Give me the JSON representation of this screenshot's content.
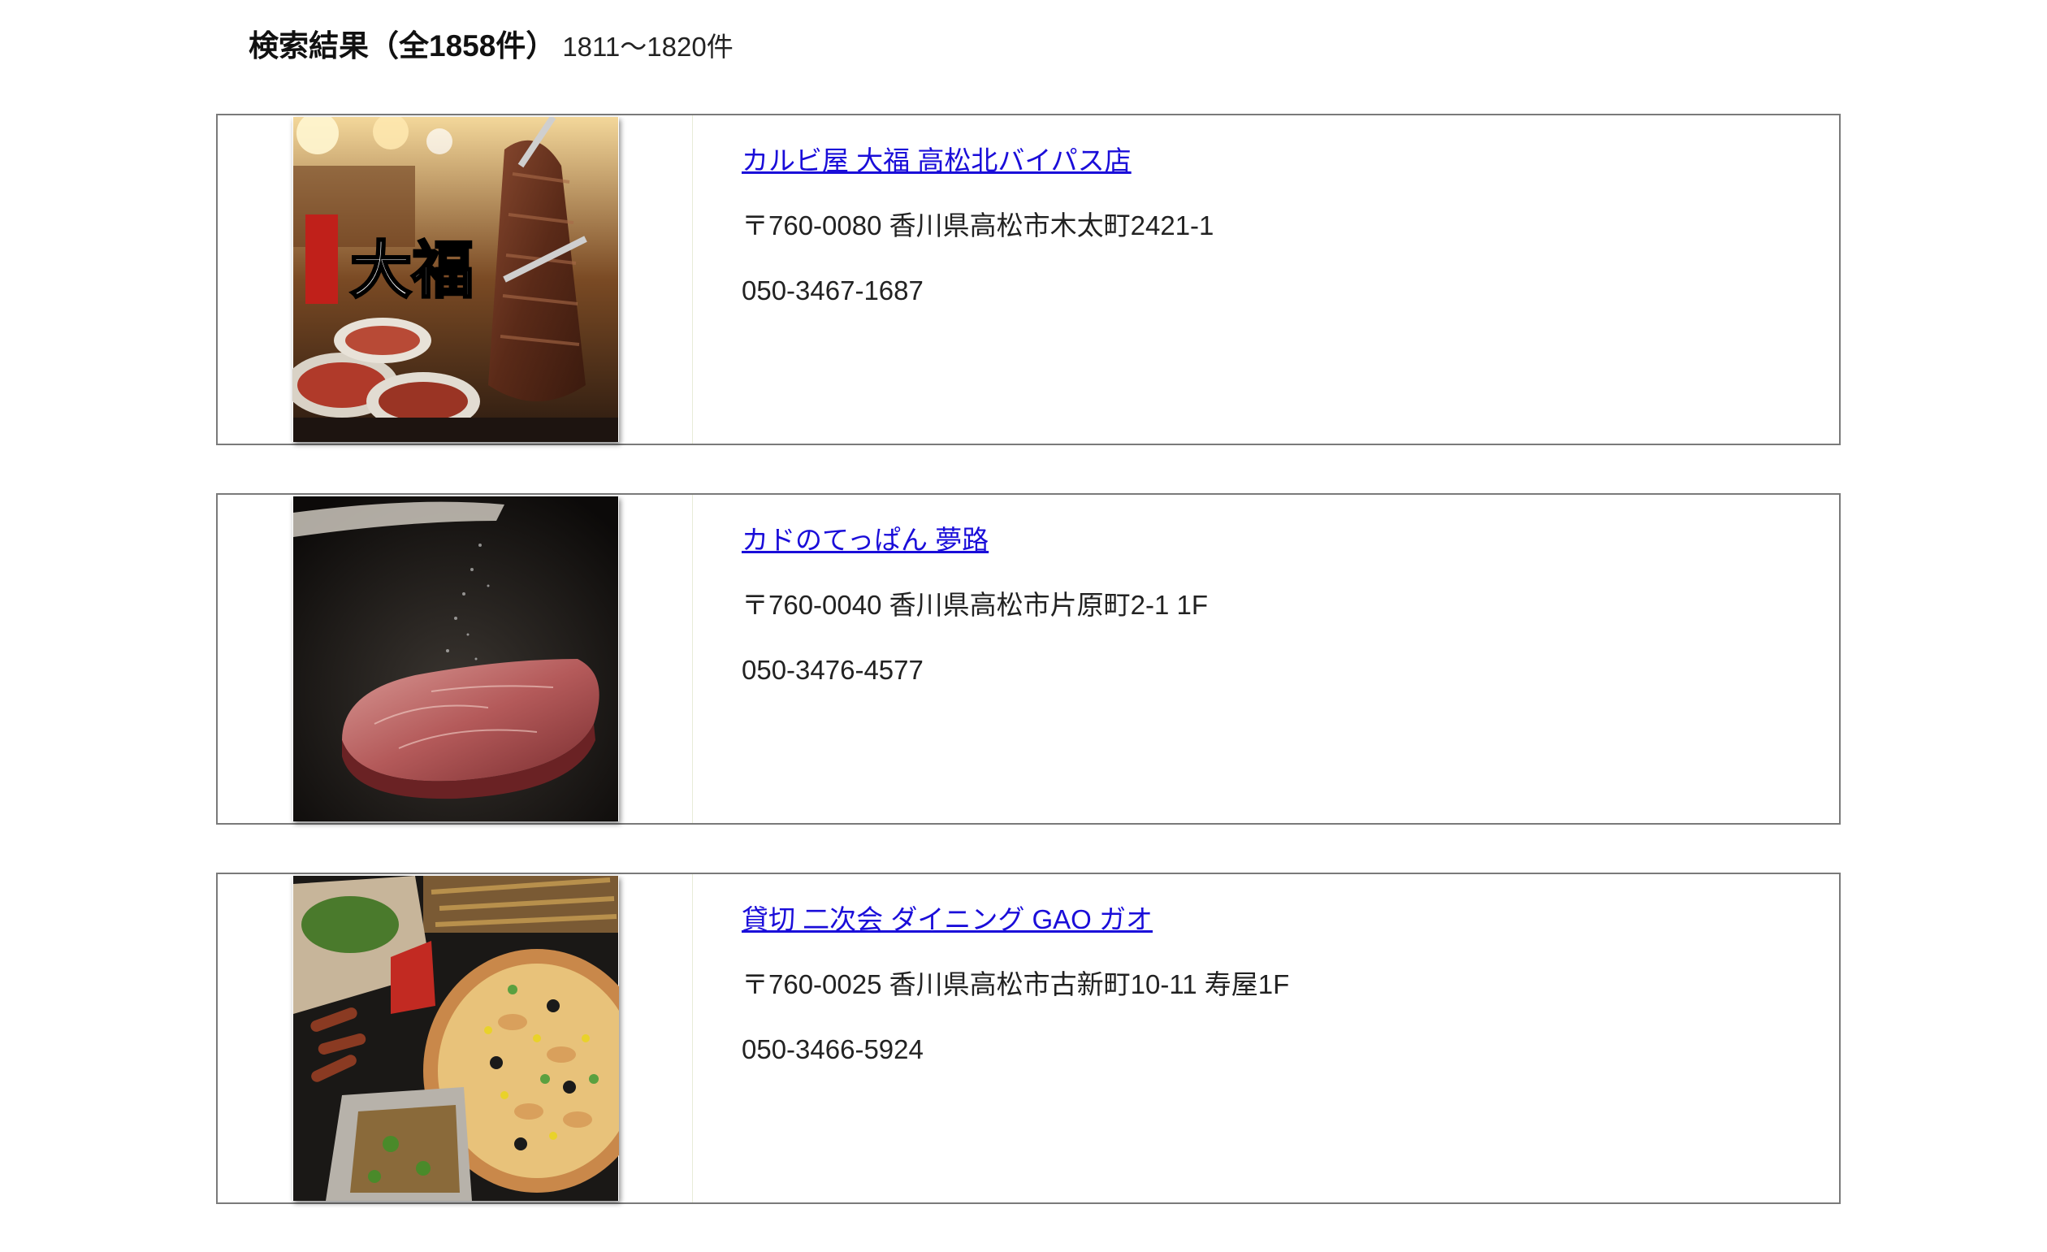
{
  "header": {
    "title": "検索結果（全1858件）",
    "range": "1811〜1820件"
  },
  "results": [
    {
      "name": "カルビ屋 大福 高松北バイパス店",
      "address": "〒760-0080 香川県高松市木太町2421-1",
      "phone": "050-3467-1687",
      "image_icon": "grilled-beef-photo",
      "image_logo_text": "大福"
    },
    {
      "name": "カドのてっぱん 夢路",
      "address": "〒760-0040 香川県高松市片原町2-1 1F",
      "phone": "050-3476-4577",
      "image_icon": "teppan-steak-photo"
    },
    {
      "name": "貸切 二次会 ダイニング GAO ガオ",
      "address": "〒760-0025 香川県高松市古新町10-11 寿屋1F",
      "phone": "050-3466-5924",
      "image_icon": "party-food-platter-photo"
    }
  ],
  "colors": {
    "link": "#1a0dd9",
    "card_border": "#7a7a7a"
  }
}
